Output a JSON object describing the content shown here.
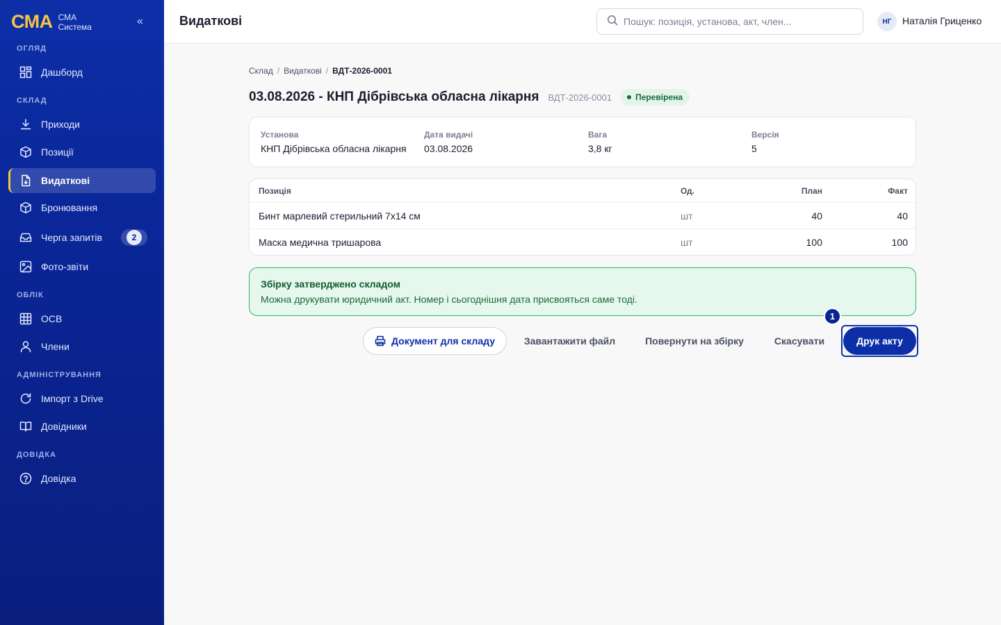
{
  "brand": {
    "logo": "СМА",
    "line1": "СМА",
    "line2": "Система",
    "collapse": "«"
  },
  "sidebar": {
    "sections": [
      "ОГЛЯД",
      "СКЛАД",
      "ОБЛІК",
      "АДМІНІСТРУВАННЯ",
      "ДОВІДКА"
    ],
    "items": [
      {
        "label": "Дашборд",
        "icon": "grid-icon"
      },
      {
        "label": "Приходи",
        "icon": "download-icon"
      },
      {
        "label": "Позиції",
        "icon": "box-icon"
      },
      {
        "label": "Видаткові",
        "icon": "file-icon",
        "active": true
      },
      {
        "label": "Бронювання",
        "icon": "box-icon"
      },
      {
        "label": "Черга запитів",
        "icon": "inbox-icon",
        "badge": "2"
      },
      {
        "label": "Фото-звіти",
        "icon": "image-icon"
      },
      {
        "label": "ОСВ",
        "icon": "table-icon"
      },
      {
        "label": "Члени",
        "icon": "user-icon"
      },
      {
        "label": "Імпорт з Drive",
        "icon": "refresh-icon"
      },
      {
        "label": "Довідники",
        "icon": "book-icon"
      },
      {
        "label": "Довідка",
        "icon": "help-icon"
      }
    ]
  },
  "header": {
    "title": "Видаткові",
    "search_placeholder": "Пошук: позиція, установа, акт, член...",
    "avatar_initials": "НГ",
    "user_name": "Наталія Гриценко"
  },
  "breadcrumb": {
    "items": [
      "Склад",
      "Видаткові",
      "ВДТ-2026-0001"
    ],
    "sep": "/"
  },
  "document": {
    "title": "03.08.2026 - КНП Дібрівська обласна лікарня",
    "number": "ВДТ-2026-0001",
    "status": "Перевірена",
    "info": [
      {
        "key": "Установа",
        "value": "КНП Дібрівська обласна лікарня"
      },
      {
        "key": "Дата видачі",
        "value": "03.08.2026"
      },
      {
        "key": "Вага",
        "value": "3,8 кг"
      },
      {
        "key": "Версія",
        "value": "5"
      }
    ]
  },
  "table": {
    "columns": [
      "Позиція",
      "Од.",
      "План",
      "Факт"
    ],
    "rows": [
      {
        "position": "Бинт марлевий стерильний 7х14 см",
        "unit": "шт",
        "plan": "40",
        "fact": "40"
      },
      {
        "position": "Маска медична тришарова",
        "unit": "шт",
        "plan": "100",
        "fact": "100"
      }
    ]
  },
  "alert": {
    "title": "Збірку затверджено складом",
    "text": "Можна друкувати юридичний акт. Номер і сьогоднішня дата присвояться саме тоді."
  },
  "actions": {
    "warehouse_doc": "Документ для складу",
    "download": "Завантажити файл",
    "return": "Повернути на збірку",
    "cancel": "Скасувати",
    "print": "Друк акту",
    "step": "1"
  },
  "colors": {
    "sidebar": "#0c2fa8",
    "accent": "#f5c542",
    "success": "#34b36b",
    "primary": "#0c2fa8"
  }
}
